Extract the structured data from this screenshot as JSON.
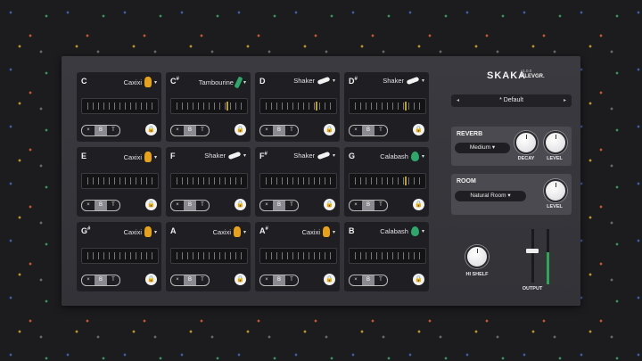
{
  "pads": [
    {
      "note": "C",
      "sharp": "",
      "instrument": "Caxixi",
      "icon": "caxixi-icon",
      "icon_color": "#e8a21a",
      "marker": false
    },
    {
      "note": "C",
      "sharp": "#",
      "instrument": "Tambourine",
      "icon": "tambourine-icon",
      "icon_color": "#2ea86a",
      "marker": true
    },
    {
      "note": "D",
      "sharp": "",
      "instrument": "Shaker",
      "icon": "shaker-icon",
      "icon_color": "#f2f2f2",
      "marker": true
    },
    {
      "note": "D",
      "sharp": "#",
      "instrument": "Shaker",
      "icon": "shaker-icon",
      "icon_color": "#f2f2f2",
      "marker": true
    },
    {
      "note": "E",
      "sharp": "",
      "instrument": "Caxixi",
      "icon": "caxixi-icon",
      "icon_color": "#e8a21a",
      "marker": false
    },
    {
      "note": "F",
      "sharp": "",
      "instrument": "Shaker",
      "icon": "shaker-icon",
      "icon_color": "#f2f2f2",
      "marker": false
    },
    {
      "note": "F",
      "sharp": "#",
      "instrument": "Shaker",
      "icon": "shaker-icon",
      "icon_color": "#f2f2f2",
      "marker": false
    },
    {
      "note": "G",
      "sharp": "",
      "instrument": "Calabash",
      "icon": "calabash-icon",
      "icon_color": "#2ea86a",
      "marker": true
    },
    {
      "note": "G",
      "sharp": "#",
      "instrument": "Caxixi",
      "icon": "caxixi-icon",
      "icon_color": "#e8a21a",
      "marker": false
    },
    {
      "note": "A",
      "sharp": "",
      "instrument": "Caxixi",
      "icon": "caxixi-icon",
      "icon_color": "#e8a21a",
      "marker": false
    },
    {
      "note": "A",
      "sharp": "#",
      "instrument": "Caxixi",
      "icon": "caxixi-icon",
      "icon_color": "#e8a21a",
      "marker": false
    },
    {
      "note": "B",
      "sharp": "",
      "instrument": "Calabash",
      "icon": "calabash-icon",
      "icon_color": "#2ea86a",
      "marker": false
    }
  ],
  "mode_labels": [
    "×",
    "B",
    "T"
  ],
  "active_mode": "B",
  "header": {
    "logo": "SKAKA",
    "version": "v1.0.0",
    "brand": "KLEVGR."
  },
  "preset": {
    "value": "* Default",
    "prev": "◂",
    "next": "▸"
  },
  "reverb": {
    "title": "REVERB",
    "type": "Medium",
    "decay_label": "DECAY",
    "level_label": "LEVEL"
  },
  "room": {
    "title": "ROOM",
    "type": "Natural Room",
    "level_label": "LEVEL"
  },
  "output": {
    "hi_shelf_label": "HI SHELF",
    "output_label": "OUTPUT"
  },
  "colors": {
    "accent_green": "#2fa55a",
    "accent_gold": "#e8a21a",
    "marker": "#b8a030"
  }
}
